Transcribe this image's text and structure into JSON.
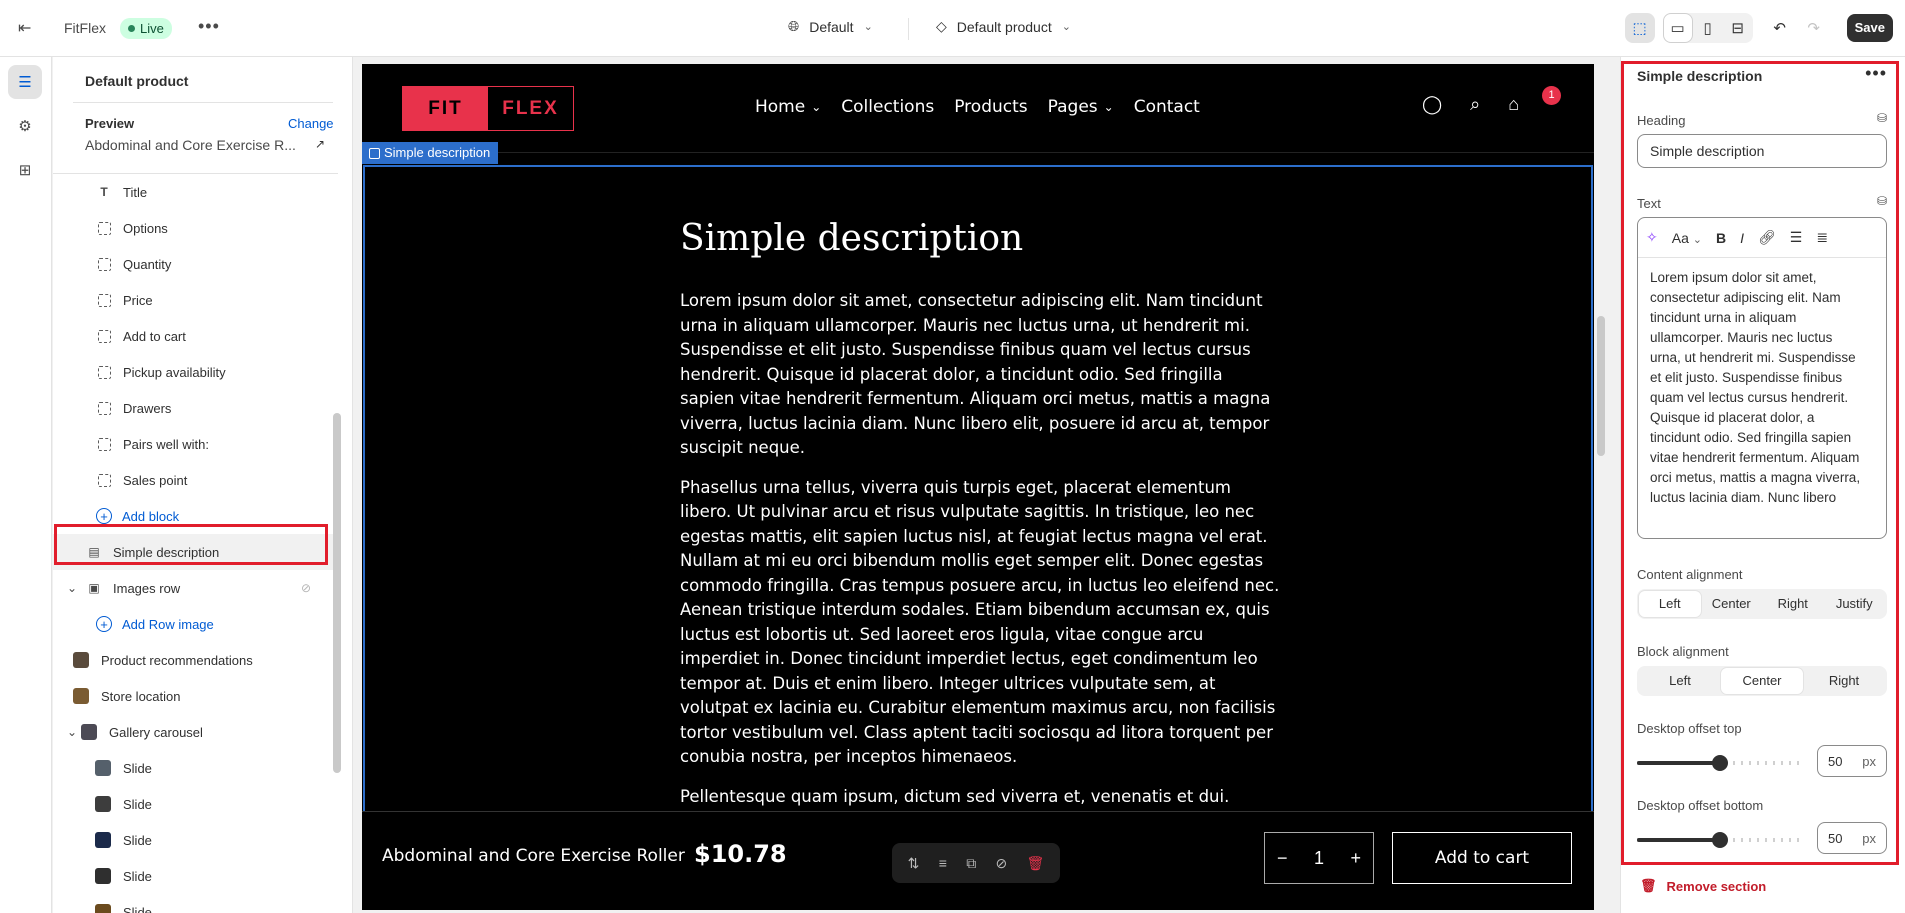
{
  "topbar": {
    "app_name": "FitFlex",
    "status": "Live",
    "theme": "Default",
    "template": "Default product",
    "save_label": "Save"
  },
  "left_panel": {
    "title": "Default product",
    "preview_label": "Preview",
    "change_label": "Change",
    "preview_value": "Abdominal and Core Exercise R..."
  },
  "tree": {
    "items": [
      {
        "label": "Title"
      },
      {
        "label": "Options"
      },
      {
        "label": "Quantity"
      },
      {
        "label": "Price"
      },
      {
        "label": "Add to cart"
      },
      {
        "label": "Pickup availability"
      },
      {
        "label": "Drawers"
      },
      {
        "label": "Pairs well with:"
      },
      {
        "label": "Sales point"
      },
      {
        "label": "Add block"
      },
      {
        "label": "Simple description"
      },
      {
        "label": "Images row"
      },
      {
        "label": "Add Row image"
      },
      {
        "label": "Product recommendations"
      },
      {
        "label": "Store location"
      },
      {
        "label": "Gallery carousel"
      },
      {
        "label": "Slide"
      },
      {
        "label": "Slide"
      },
      {
        "label": "Slide"
      },
      {
        "label": "Slide"
      },
      {
        "label": "Slide"
      }
    ]
  },
  "site": {
    "logo_a": "FIT",
    "logo_b": "FLEX",
    "nav": [
      "Home",
      "Collections",
      "Products",
      "Pages",
      "Contact"
    ],
    "cart_count": "1",
    "section_tag": "Simple description"
  },
  "article": {
    "heading": "Simple description",
    "p1": "Lorem ipsum dolor sit amet, consectetur adipiscing elit. Nam tincidunt urna in aliquam ullamcorper. Mauris nec luctus urna, ut hendrerit mi. Suspendisse et elit justo. Suspendisse finibus quam vel lectus cursus hendrerit. Quisque id placerat dolor, a tincidunt odio. Sed fringilla sapien vitae hendrerit fermentum. Aliquam orci metus, mattis a magna viverra, luctus lacinia diam. Nunc libero elit, posuere id arcu at, tempor suscipit neque.",
    "p2": "Phasellus urna tellus, viverra quis turpis eget, placerat elementum libero. Ut pulvinar arcu et risus vulputate sagittis. In tristique, leo nec egestas mattis, elit sapien luctus nisl, at feugiat lectus magna vel erat. Nullam at mi eu orci bibendum mollis eget semper elit. Donec egestas commodo fringilla. Cras tempus posuere arcu, in luctus leo eleifend nec. Aenean tristique interdum sodales. Etiam bibendum accumsan ex, quis luctus est lobortis ut. Sed laoreet eros ligula, vitae congue arcu imperdiet in. Donec tincidunt imperdiet lectus, eget condimentum leo tempor at. Duis et enim libero. Integer ultrices vulputate sem, at volutpat ex lacinia eu. Curabitur elementum maximus arcu, non facilisis tortor vestibulum vel. Class aptent taciti sociosqu ad litora torquent per conubia nostra, per inceptos himenaeos.",
    "p3": "Pellentesque quam ipsum, dictum sed viverra et, venenatis et dui."
  },
  "sticky": {
    "product_name": "Abdominal and Core Exercise Roller",
    "price": "$10.78",
    "qty": "1",
    "minus": "−",
    "plus": "+",
    "add_to_cart": "Add to cart"
  },
  "settings": {
    "title": "Simple description",
    "heading_label": "Heading",
    "heading_value": "Simple description",
    "text_label": "Text",
    "text_value": "Lorem ipsum dolor sit amet, consectetur adipiscing elit. Nam tincidunt urna in aliquam ullamcorper. Mauris nec luctus urna, ut hendrerit mi. Suspendisse et elit justo. Suspendisse finibus quam vel lectus cursus hendrerit. Quisque id placerat dolor, a tincidunt odio. Sed fringilla sapien vitae hendrerit fermentum. Aliquam orci metus, mattis a magna viverra, luctus lacinia diam. Nunc libero",
    "font_btn": "Aa",
    "content_alignment_label": "Content alignment",
    "content_alignment": [
      "Left",
      "Center",
      "Right",
      "Justify"
    ],
    "block_alignment_label": "Block alignment",
    "block_alignment": [
      "Left",
      "Center",
      "Right"
    ],
    "offset_top_label": "Desktop offset top",
    "offset_top": "50",
    "offset_bottom_label": "Desktop offset bottom",
    "offset_bottom": "50",
    "unit": "px",
    "offset_top_fraction": 0.5,
    "offset_bottom_fraction": 0.5,
    "remove_label": "Remove section"
  },
  "colors": {
    "accent": "#005bd3",
    "brand": "#e8324b",
    "highlight": "#e11d2b"
  }
}
